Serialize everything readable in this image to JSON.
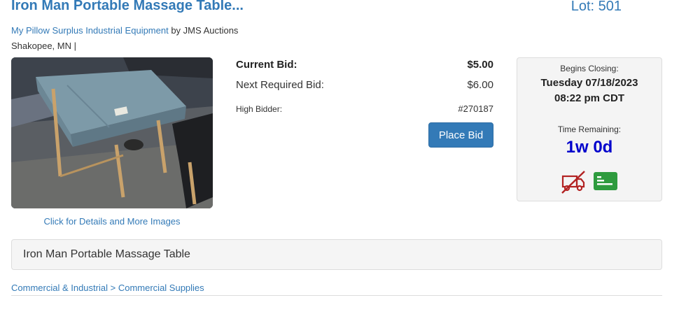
{
  "listing": {
    "title": "Iron Man Portable Massage Table...",
    "lot": "Lot: 501",
    "seller_link": "My Pillow Surplus Industrial Equipment",
    "by_text": " by JMS Auctions",
    "location": "Shakopee, MN |",
    "details_link": "Click for Details and More Images",
    "photo_tag_text": "AB47"
  },
  "bid": {
    "current_label": "Current Bid:",
    "current_value": "$5.00",
    "next_label": "Next Required Bid:",
    "next_value": "$6.00",
    "high_bidder_label": "High Bidder:",
    "high_bidder_value": "#270187",
    "place_bid_label": "Place Bid"
  },
  "closing": {
    "begins_label": "Begins Closing:",
    "date": "Tuesday 07/18/2023",
    "time": "08:22 pm CDT",
    "remaining_label": "Time Remaining:",
    "remaining_value": "1w 0d",
    "icons": [
      "no-shipping-icon",
      "payment-card-icon"
    ]
  },
  "description": {
    "text": "Iron Man Portable Massage Table"
  },
  "category": {
    "items": [
      "Commercial & Industrial",
      "Commercial Supplies"
    ],
    "separator": ">"
  },
  "colors": {
    "link": "#337ab7",
    "primary_button": "#337ab7",
    "time_remaining": "#0000cc",
    "no_shipping": "#b22222",
    "payment_badge": "#2e9b3e"
  }
}
